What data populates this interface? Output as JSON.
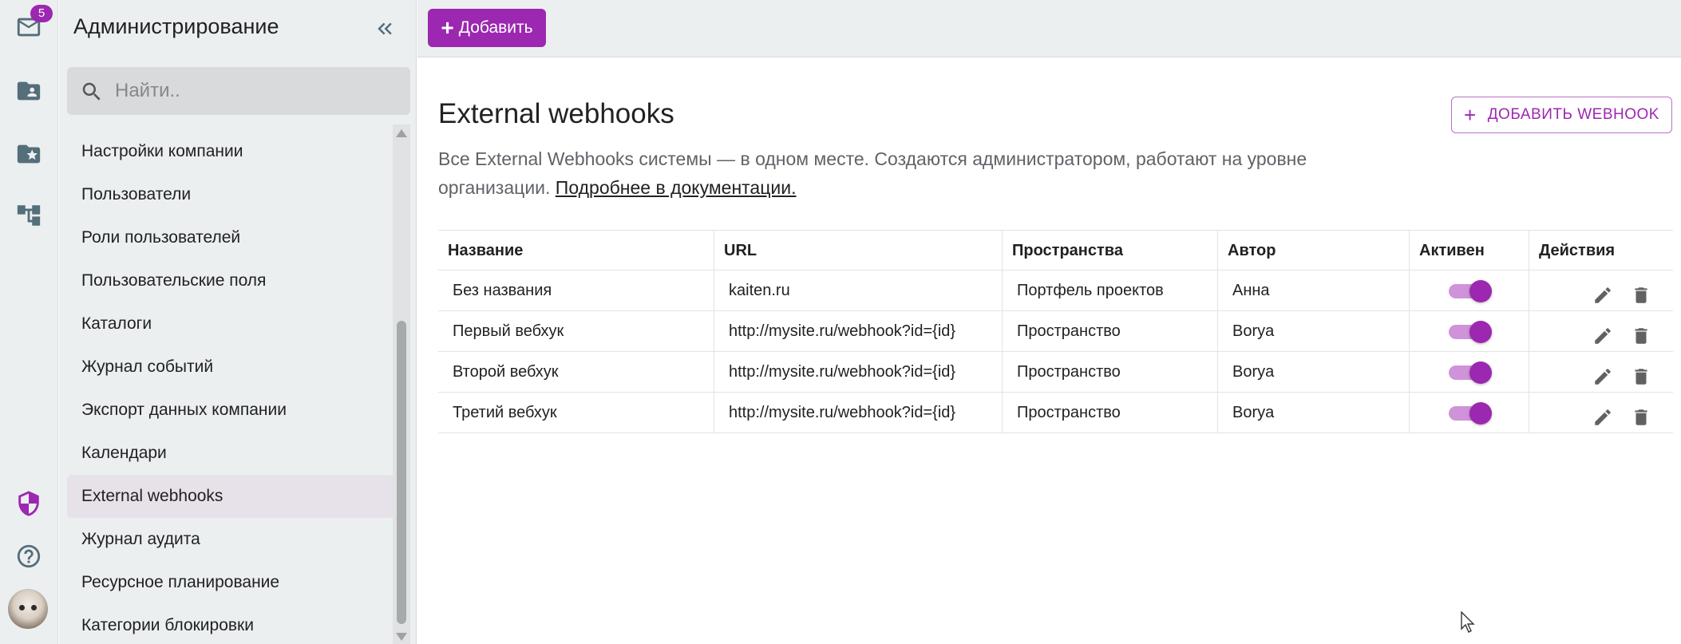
{
  "rail": {
    "mail_badge": "5",
    "icons": [
      "mail-icon",
      "folder-person-icon",
      "folder-star-icon",
      "hierarchy-icon",
      "shield-icon",
      "help-icon",
      "avatar"
    ]
  },
  "sidebar": {
    "title": "Администрирование",
    "search_placeholder": "Найти..",
    "items": [
      {
        "label": "Настройки компании"
      },
      {
        "label": "Пользователи"
      },
      {
        "label": "Роли пользователей"
      },
      {
        "label": "Пользовательские поля"
      },
      {
        "label": "Каталоги"
      },
      {
        "label": "Журнал событий"
      },
      {
        "label": "Экспорт данных компании"
      },
      {
        "label": "Календари"
      },
      {
        "label": "External webhooks",
        "active": true
      },
      {
        "label": "Журнал аудита"
      },
      {
        "label": "Ресурсное планирование"
      },
      {
        "label": "Категории блокировки"
      }
    ]
  },
  "topbar": {
    "add_label": "Добавить"
  },
  "main": {
    "title": "External webhooks",
    "add_webhook_label": "ДОБАВИТЬ WEBHOOK",
    "description": "Все External Webhooks системы — в одном месте. Создаются администратором, работают на уровне организации.",
    "doc_link": "Подробнее в документации.",
    "table": {
      "headers": [
        "Название",
        "URL",
        "Пространства",
        "Автор",
        "Активен",
        "Действия"
      ],
      "rows": [
        {
          "name": "Без названия",
          "url": "kaiten.ru",
          "space": "Портфель проектов",
          "author": "Анна",
          "active": true
        },
        {
          "name": "Первый вебхук",
          "url": "http://mysite.ru/webhook?id={id}",
          "space": "Пространство",
          "author": "Borya",
          "active": true
        },
        {
          "name": "Второй вебхук",
          "url": "http://mysite.ru/webhook?id={id}",
          "space": "Пространство",
          "author": "Borya",
          "active": true
        },
        {
          "name": "Третий вебхук",
          "url": "http://mysite.ru/webhook?id={id}",
          "space": "Пространство",
          "author": "Borya",
          "active": true
        }
      ]
    }
  },
  "colors": {
    "accent": "#9c27b0",
    "accent_light": "#cf93d9",
    "sidebar_bg": "#eceff0",
    "active_item_bg": "#e7e1ea"
  }
}
